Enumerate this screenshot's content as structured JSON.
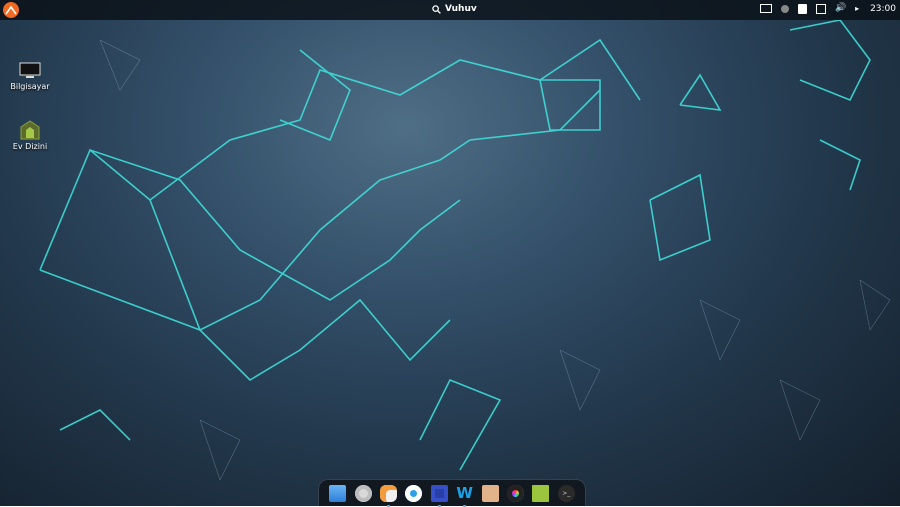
{
  "topbar": {
    "search_label": "Vuhuv",
    "clock": "23:00",
    "tray_icons": [
      "keyboard-layout-icon",
      "info-icon",
      "notes-icon",
      "network-icon",
      "volume-icon",
      "night-mode-icon"
    ]
  },
  "desktop": {
    "icons": [
      {
        "label": "Bilgisayar",
        "icon": "computer-icon"
      },
      {
        "label": "Ev Dizini",
        "icon": "home-folder-icon"
      }
    ]
  },
  "dock": {
    "apps": [
      {
        "name": "file-manager",
        "color": "#3d8fe0"
      },
      {
        "name": "settings",
        "color": "#d9d9d9"
      },
      {
        "name": "control-center",
        "color": "#f1f1f1"
      },
      {
        "name": "browser",
        "color": "#e8f4ff"
      },
      {
        "name": "media-player",
        "color": "#2a3ea8"
      },
      {
        "name": "wps-writer",
        "color": "#1aa3e8"
      },
      {
        "name": "image-viewer",
        "color": "#e2b28a"
      },
      {
        "name": "color-picker",
        "color": "#222"
      },
      {
        "name": "folder",
        "color": "#9bc53d"
      },
      {
        "name": "terminal",
        "color": "#2a2a2a"
      }
    ]
  },
  "colors": {
    "accent": "#3de8e0",
    "menu": "#f06a23"
  }
}
